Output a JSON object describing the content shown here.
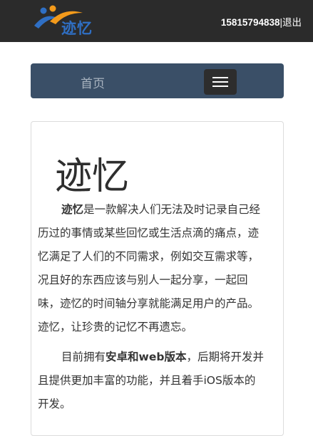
{
  "header": {
    "logo_text": "迹忆",
    "phone": "15815794838",
    "separator": "|",
    "logout": "退出"
  },
  "nav": {
    "home": "首页"
  },
  "content": {
    "title": "迹忆",
    "p1": {
      "line1_bold": "迹忆",
      "line1_rest": "是一款解决人们无法及时记录自己经",
      "line2": "历过的事情或某些回忆或生活点滴的痛点，迹",
      "line3": "忆满足了人们的不同需求，例如交互需求等，",
      "line4": "况且好的东西应该与别人一起分享，一起回",
      "line5": "味，迹忆的时间轴分享就能满足用户的产品。",
      "line6": "迹忆，让珍贵的记忆不再遗忘。"
    },
    "p2": {
      "line1_a": "目前拥有",
      "line1_bold": "安卓和web版本",
      "line1_b": "，后期将开发并",
      "line2": "且提供更加丰富的功能，并且着手iOS版本的",
      "line3": "开发。"
    }
  },
  "colors": {
    "topbar": "#2b2b2b",
    "navbar": "#3a4f67",
    "logo_blue": "#2f6fc4",
    "logo_orange": "#f39a1b"
  }
}
